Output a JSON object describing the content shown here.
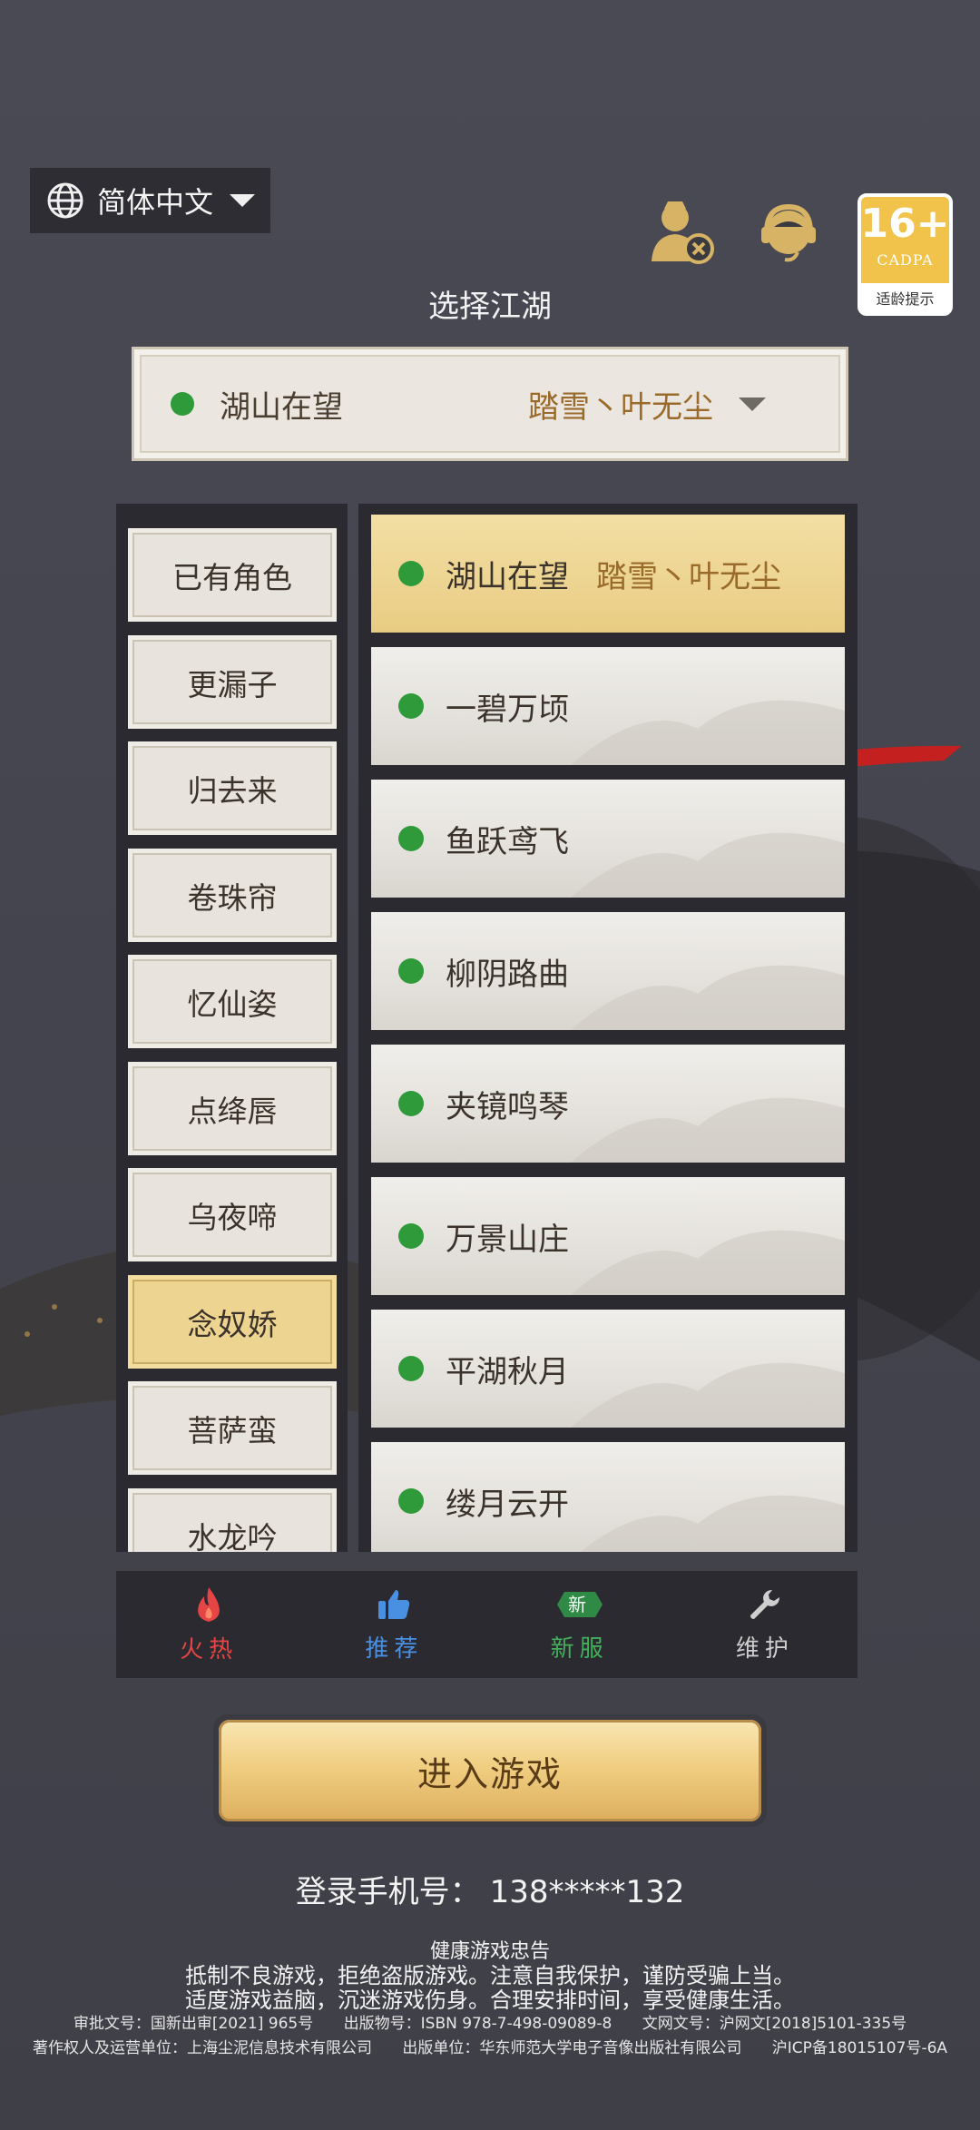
{
  "language": {
    "label": "简体中文"
  },
  "age_rating": {
    "rating": "16+",
    "org": "CADPA",
    "tip": "适龄提示"
  },
  "title": "选择江湖",
  "selected_server": {
    "name": "湖山在望",
    "role": "踏雪丶叶无尘"
  },
  "categories": [
    {
      "label": "已有角色",
      "active": false
    },
    {
      "label": "更漏子",
      "active": false
    },
    {
      "label": "归去来",
      "active": false
    },
    {
      "label": "卷珠帘",
      "active": false
    },
    {
      "label": "忆仙姿",
      "active": false
    },
    {
      "label": "点绛唇",
      "active": false
    },
    {
      "label": "乌夜啼",
      "active": false
    },
    {
      "label": "念奴娇",
      "active": true
    },
    {
      "label": "菩萨蛮",
      "active": false
    },
    {
      "label": "水龙吟",
      "active": false
    }
  ],
  "servers": [
    {
      "name": "湖山在望",
      "role": "踏雪丶叶无尘",
      "active": true
    },
    {
      "name": "一碧万顷",
      "role": "",
      "active": false
    },
    {
      "name": "鱼跃鸢飞",
      "role": "",
      "active": false
    },
    {
      "name": "柳阴路曲",
      "role": "",
      "active": false
    },
    {
      "name": "夹镜鸣琴",
      "role": "",
      "active": false
    },
    {
      "name": "万景山庄",
      "role": "",
      "active": false
    },
    {
      "name": "平湖秋月",
      "role": "",
      "active": false
    },
    {
      "name": "缕月云开",
      "role": "",
      "active": false
    }
  ],
  "filter_tabs": [
    {
      "label": "火热",
      "icon": "fire-icon",
      "color": "#e64545"
    },
    {
      "label": "推荐",
      "icon": "thumbs-up-icon",
      "color": "#4a90e2"
    },
    {
      "label": "新服",
      "icon": "new-badge-icon",
      "badge": "新",
      "color": "#43b05c"
    },
    {
      "label": "维护",
      "icon": "wrench-icon",
      "color": "#cfcfcf"
    }
  ],
  "enter_button": "进入游戏",
  "login_phone": {
    "label": "登录手机号：",
    "value": "138*****132"
  },
  "health_notice": {
    "title": "健康游戏忠告",
    "line1": "抵制不良游戏，拒绝盗版游戏。注意自我保护，谨防受骗上当。",
    "line2": "适度游戏益脑，沉迷游戏伤身。合理安排时间，享受健康生活。"
  },
  "legal": {
    "approval": "审批文号：国新出审[2021] 965号",
    "publication": "出版物号：ISBN 978-7-498-09089-8",
    "culture": "文网文号：沪网文[2018]5101-335号",
    "copyright": "著作权人及运营单位：上海尘泥信息技术有限公司",
    "publisher": "出版单位：华东师范大学电子音像出版社有限公司",
    "icp": "沪ICP备18015107号-6A"
  },
  "colors": {
    "accent_gold": "#e8cc83",
    "online_green": "#2e9a3a",
    "panel_dark": "#2a2a30"
  }
}
